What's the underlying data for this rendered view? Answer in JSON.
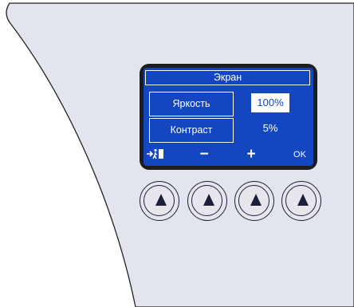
{
  "display": {
    "title": "Экран",
    "menu": [
      {
        "label": "Яркость",
        "value": "100%",
        "selected": true
      },
      {
        "label": "Контраст",
        "value": "5%",
        "selected": false
      }
    ],
    "softkeys": {
      "exit_icon": "exit-door-icon",
      "minus": "−",
      "plus": "+",
      "ok": "OK"
    }
  },
  "buttons": [
    {
      "icon": "up-arrow-icon"
    },
    {
      "icon": "up-arrow-icon"
    },
    {
      "icon": "up-arrow-icon"
    },
    {
      "icon": "up-arrow-icon"
    }
  ],
  "colors": {
    "panel": "#e3e5ee",
    "screen": "#1446c2",
    "bezel": "#1d1d1f",
    "outline": "#1c1f3a"
  }
}
